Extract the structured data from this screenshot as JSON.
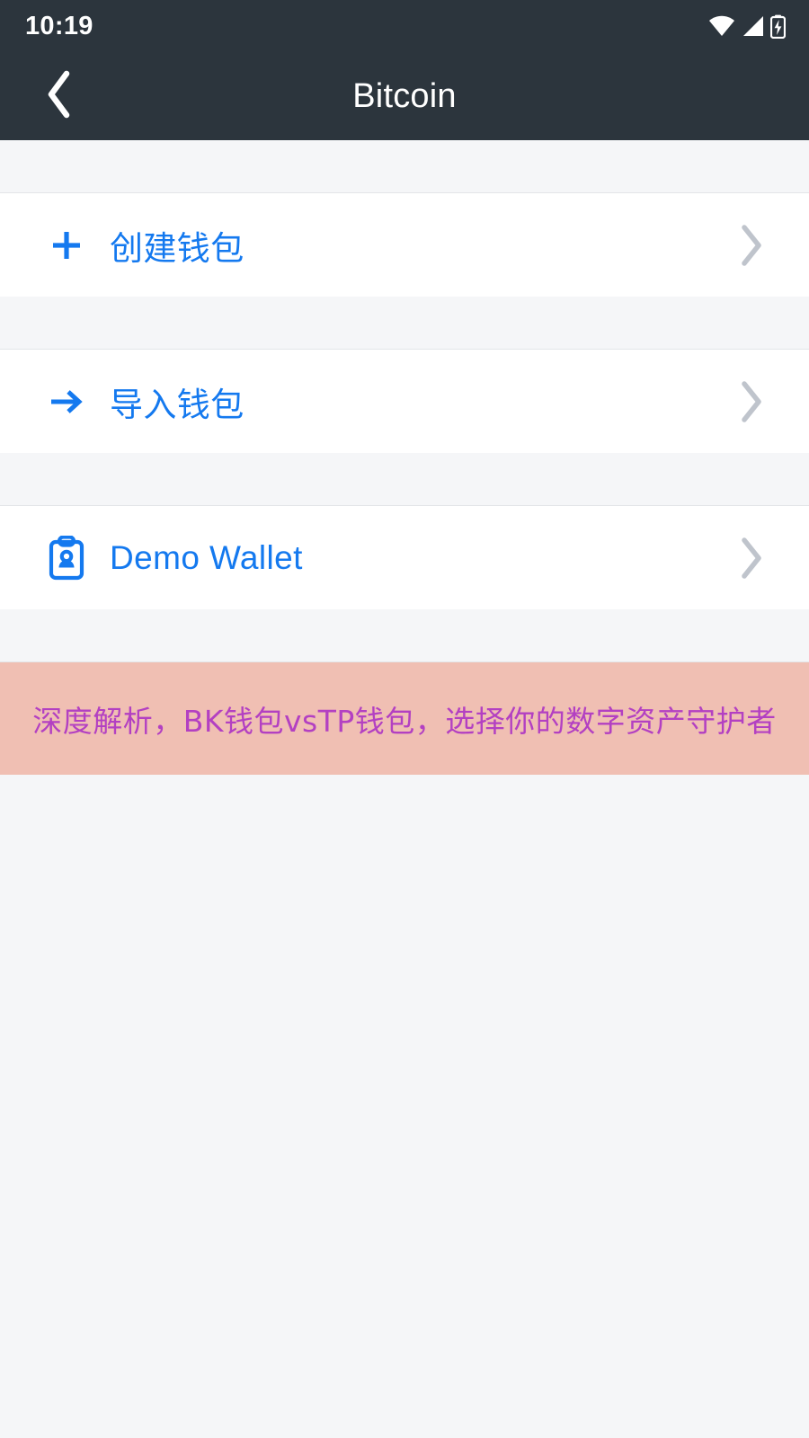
{
  "status_bar": {
    "time": "10:19",
    "icons": [
      "wifi-icon",
      "cellular-signal-icon",
      "battery-charging-icon"
    ]
  },
  "app_bar": {
    "title": "Bitcoin",
    "back_icon": "chevron-left-icon",
    "background_color": "#2c353d",
    "title_color": "#ffffff"
  },
  "list": {
    "accent_color": "#1479ef",
    "chevron_color": "#bfc4cc",
    "rows": [
      {
        "icon": "plus-icon",
        "label": "创建钱包",
        "chevron": "chevron-right-icon"
      },
      {
        "icon": "arrow-right-icon",
        "label": "导入钱包",
        "chevron": "chevron-right-icon"
      },
      {
        "icon": "contact-card-icon",
        "label": "Demo Wallet",
        "chevron": "chevron-right-icon"
      }
    ]
  },
  "promo_banner": {
    "text": "深度解析，BK钱包vsTP钱包，选择你的数字资产守护者",
    "background_color": "#f0bfb3",
    "text_color": "#b340c2"
  },
  "page": {
    "background_color": "#f5f6f8"
  }
}
